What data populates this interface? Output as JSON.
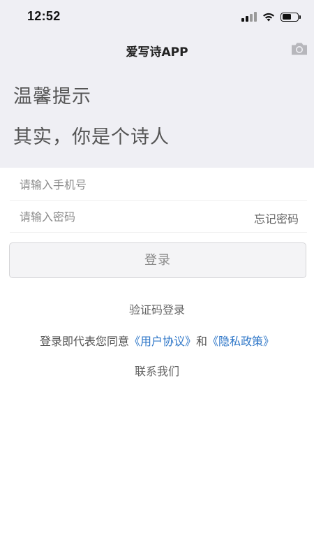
{
  "status_bar": {
    "time": "12:52"
  },
  "navbar": {
    "title": "爱写诗APP",
    "right_icon": "camera-icon"
  },
  "tip": {
    "title": "温馨提示",
    "text": "其实，你是个诗人"
  },
  "form": {
    "phone_placeholder": "请输入手机号",
    "password_placeholder": "请输入密码",
    "forgot_label": "忘记密码",
    "login_label": "登录"
  },
  "links": {
    "sms_login": "验证码登录",
    "agreement_prefix": "登录即代表您同意",
    "user_agreement": "《用户协议》",
    "conjunction": "和",
    "privacy_policy": "《隐私政策》",
    "contact": "联系我们"
  },
  "colors": {
    "top_bg": "#efeff4",
    "link": "#2f77c8"
  }
}
